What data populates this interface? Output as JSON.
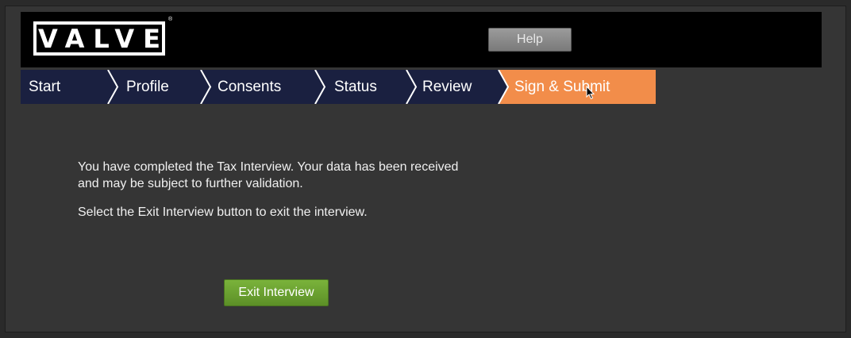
{
  "header": {
    "logo_text": "VALVE",
    "logo_reg": "®",
    "help_label": "Help"
  },
  "steps": [
    {
      "label": "Start",
      "state": "completed"
    },
    {
      "label": "Profile",
      "state": "completed"
    },
    {
      "label": "Consents",
      "state": "completed"
    },
    {
      "label": "Status",
      "state": "completed"
    },
    {
      "label": "Review",
      "state": "completed"
    },
    {
      "label": "Sign & Submit",
      "state": "active"
    }
  ],
  "colors": {
    "step_bg": "#1a2040",
    "step_active": "#f28d4a",
    "exit_button": "#6a9e30"
  },
  "content": {
    "line1": "You have completed the Tax Interview. Your data has been received",
    "line2": "and may be subject to further validation.",
    "instruction": "Select the Exit Interview button to exit the interview."
  },
  "actions": {
    "exit_label": "Exit Interview"
  }
}
